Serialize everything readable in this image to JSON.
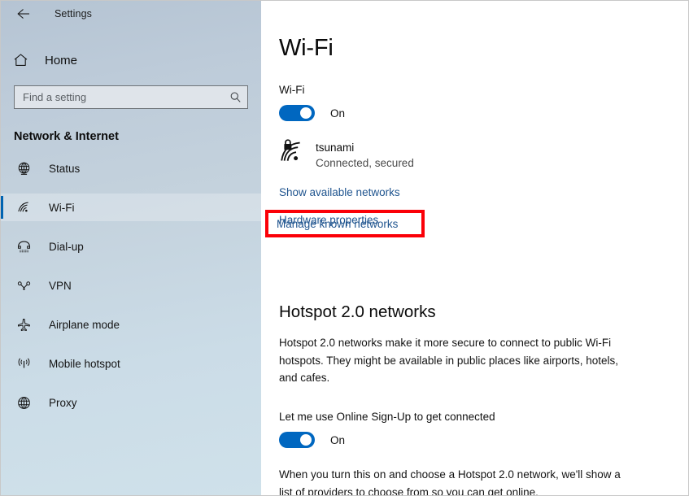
{
  "window": {
    "title": "Settings",
    "back_icon": "back-arrow-icon"
  },
  "sidebar": {
    "home_label": "Home",
    "home_icon": "home-icon",
    "search": {
      "placeholder": "Find a setting",
      "value": "",
      "icon": "search-icon"
    },
    "category_title": "Network & Internet",
    "items": [
      {
        "label": "Status",
        "icon": "globe-status-icon",
        "selected": false
      },
      {
        "label": "Wi-Fi",
        "icon": "wifi-icon",
        "selected": true
      },
      {
        "label": "Dial-up",
        "icon": "dialup-phone-icon",
        "selected": false
      },
      {
        "label": "VPN",
        "icon": "vpn-key-icon",
        "selected": false
      },
      {
        "label": "Airplane mode",
        "icon": "airplane-icon",
        "selected": false
      },
      {
        "label": "Mobile hotspot",
        "icon": "mobile-hotspot-icon",
        "selected": false
      },
      {
        "label": "Proxy",
        "icon": "globe-proxy-icon",
        "selected": false
      }
    ]
  },
  "main": {
    "page_title": "Wi-Fi",
    "wifi_toggle": {
      "label": "Wi-Fi",
      "state": "On",
      "on": true
    },
    "connected_network": {
      "name": "tsunami",
      "status": "Connected, secured",
      "icon": "wifi-secured-icon"
    },
    "links": [
      "Show available networks",
      "Hardware properties",
      "Manage known networks"
    ],
    "highlight": {
      "target": "Manage known networks",
      "color": "#fb0007"
    },
    "hotspot": {
      "heading": "Hotspot 2.0 networks",
      "description": "Hotspot 2.0 networks make it more secure to connect to public Wi-Fi hotspots. They might be available in public places like airports, hotels, and cafes.",
      "toggle": {
        "label": "Let me use Online Sign-Up to get connected",
        "state": "On",
        "on": true
      },
      "note": "When you turn this on and choose a Hotspot 2.0 network, we'll show a list of providers to choose from so you can get online."
    }
  },
  "colors": {
    "accent": "#0067c0",
    "link": "#20558f",
    "highlight": "#fb0007",
    "selected_bar": "#0063b1"
  }
}
